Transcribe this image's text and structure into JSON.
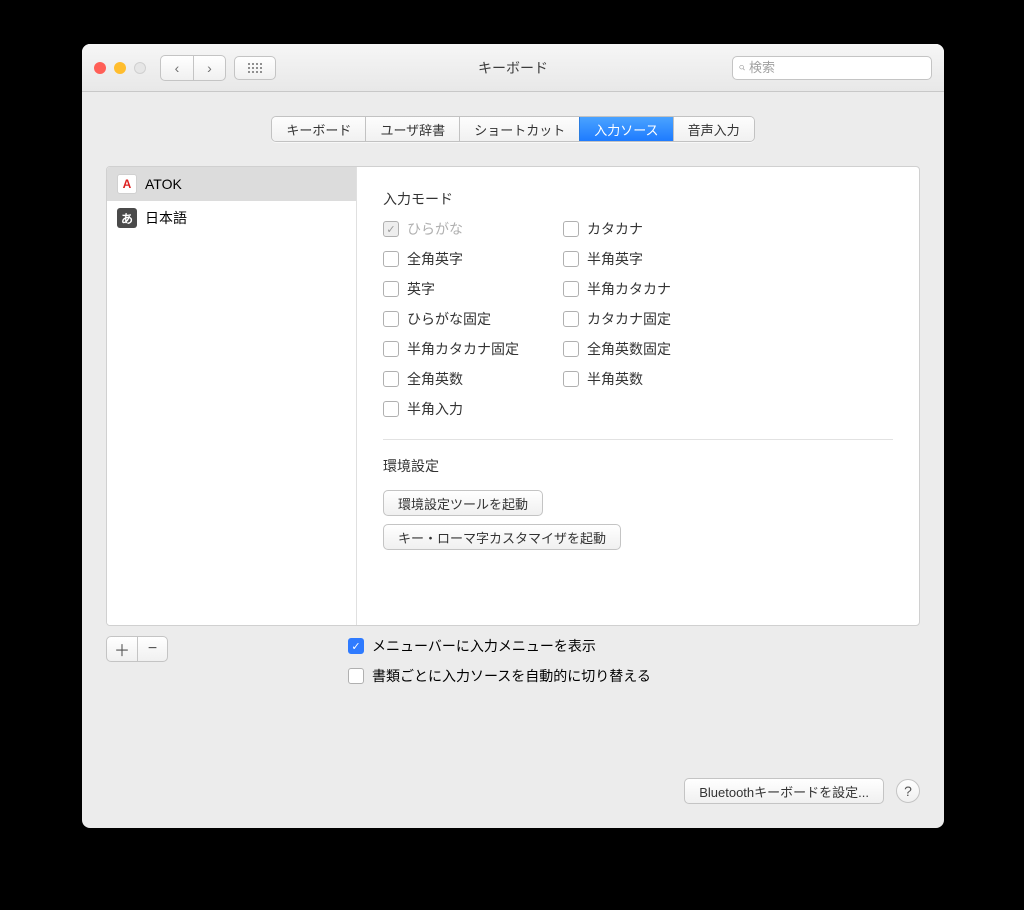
{
  "window": {
    "title": "キーボード"
  },
  "search": {
    "placeholder": "検索"
  },
  "tabs": [
    "キーボード",
    "ユーザ辞書",
    "ショートカット",
    "入力ソース",
    "音声入力"
  ],
  "tabs_active_index": 3,
  "sources": [
    {
      "label": "ATOK",
      "icon": "A",
      "selected": true
    },
    {
      "label": "日本語",
      "icon": "あ",
      "selected": false
    }
  ],
  "detail": {
    "mode_title": "入力モード",
    "modes_col1": [
      {
        "label": "ひらがな",
        "checked": true,
        "disabled": true
      },
      {
        "label": "全角英字",
        "checked": false,
        "disabled": false
      },
      {
        "label": "英字",
        "checked": false,
        "disabled": false
      },
      {
        "label": "ひらがな固定",
        "checked": false,
        "disabled": false
      },
      {
        "label": "半角カタカナ固定",
        "checked": false,
        "disabled": false
      },
      {
        "label": "全角英数",
        "checked": false,
        "disabled": false
      },
      {
        "label": "半角入力",
        "checked": false,
        "disabled": false
      }
    ],
    "modes_col2": [
      {
        "label": "カタカナ",
        "checked": false,
        "disabled": false
      },
      {
        "label": "半角英字",
        "checked": false,
        "disabled": false
      },
      {
        "label": "半角カタカナ",
        "checked": false,
        "disabled": false
      },
      {
        "label": "カタカナ固定",
        "checked": false,
        "disabled": false
      },
      {
        "label": "全角英数固定",
        "checked": false,
        "disabled": false
      },
      {
        "label": "半角英数",
        "checked": false,
        "disabled": false
      }
    ],
    "prefs_title": "環境設定",
    "btn_prefs": "環境設定ツールを起動",
    "btn_customizer": "キー・ローマ字カスタマイザを起動"
  },
  "options": {
    "show_menu": {
      "label": "メニューバーに入力メニューを表示",
      "checked": true
    },
    "auto_switch": {
      "label": "書類ごとに入力ソースを自動的に切り替える",
      "checked": false
    }
  },
  "footer": {
    "bluetooth": "Bluetoothキーボードを設定...",
    "help": "?"
  }
}
